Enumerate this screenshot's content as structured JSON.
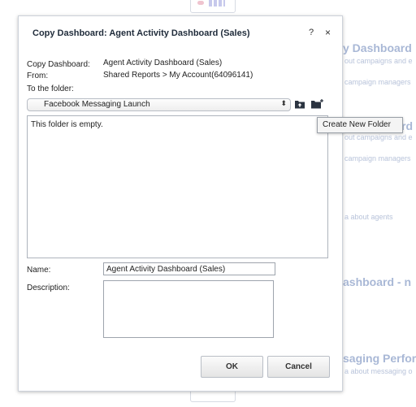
{
  "background": {
    "items": [
      {
        "title": "y Dashboard",
        "sub": "out campaigns and e",
        "sub2": "campaign managers"
      },
      {
        "title": "rd",
        "sub": "out campaigns and e",
        "sub2": "campaign managers"
      },
      {
        "sub": "a about agents"
      },
      {
        "title": "ashboard - n"
      },
      {
        "title": "saging Perfor",
        "sub": "a about messaging o"
      }
    ]
  },
  "dialog": {
    "title": "Copy Dashboard: Agent Activity Dashboard (Sales)",
    "help_label": "?",
    "close_label": "×",
    "copy_label": "Copy Dashboard:",
    "copy_value": "Agent Activity Dashboard (Sales)",
    "from_label": "From:",
    "from_value": "Shared Reports > My Account(64096141)",
    "to_folder_label": "To the folder:",
    "folder_select": {
      "selected": "Facebook Messaging Launch",
      "arrows": "⬍"
    },
    "empty_message": "This folder is empty.",
    "tooltip": "Create New Folder",
    "name_label": "Name:",
    "name_value": "Agent Activity Dashboard (Sales)",
    "description_label": "Description:",
    "description_value": "",
    "ok_label": "OK",
    "cancel_label": "Cancel"
  },
  "icons": {
    "parent_folder": "folder-up-icon",
    "new_folder": "new-folder-icon"
  },
  "colors": {
    "accent_bg_text": "#aebcd6",
    "dialog_border": "#cdd2da",
    "icon_dark": "#2a3340"
  }
}
